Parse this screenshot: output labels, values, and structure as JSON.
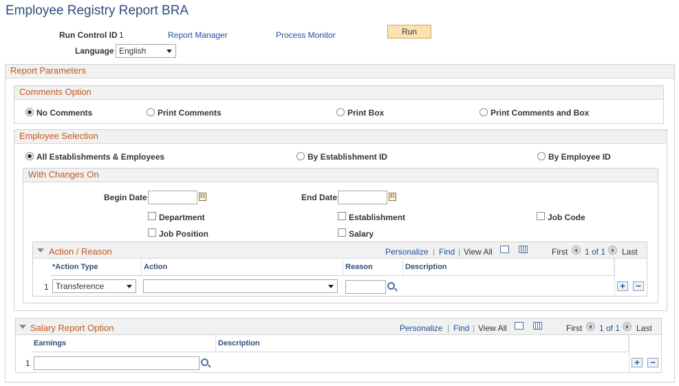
{
  "page": {
    "title": "Employee Registry Report BRA"
  },
  "header": {
    "run_control_label": "Run Control ID",
    "run_control_value": "1",
    "report_manager": "Report Manager",
    "process_monitor": "Process Monitor",
    "run_label": "Run",
    "language_label": "Language",
    "language_value": "English"
  },
  "report_parameters": {
    "title": "Report Parameters"
  },
  "comments_option": {
    "title": "Comments Option",
    "options": [
      "No Comments",
      "Print Comments",
      "Print Box",
      "Print Comments and Box"
    ],
    "selected": "No Comments"
  },
  "employee_selection": {
    "title": "Employee Selection",
    "options": [
      "All Establishments & Employees",
      "By Establishment ID",
      "By Employee ID"
    ],
    "selected": "All Establishments & Employees"
  },
  "with_changes_on": {
    "title": "With Changes On",
    "begin_date_label": "Begin Date",
    "begin_date_value": "",
    "end_date_label": "End Date",
    "end_date_value": "",
    "checkboxes": [
      "Department",
      "Establishment",
      "Job Code",
      "Job Position",
      "Salary"
    ]
  },
  "action_reason": {
    "title": "Action / Reason",
    "nav": {
      "personalize": "Personalize",
      "find": "Find",
      "view_all": "View All",
      "first": "First",
      "range": "1 of 1",
      "last": "Last",
      "sep": "|"
    },
    "columns": [
      "*Action Type",
      "Action",
      "Reason",
      "Description"
    ],
    "rows": [
      {
        "num": "1",
        "action_type": "Transference",
        "action": "",
        "reason": "",
        "description": ""
      }
    ]
  },
  "salary_report_option": {
    "title": "Salary Report Option",
    "nav": {
      "personalize": "Personalize",
      "find": "Find",
      "view_all": "View All",
      "first": "First",
      "range": "1 of 1",
      "last": "Last",
      "sep": "|"
    },
    "columns": [
      "Earnings",
      "Description"
    ],
    "rows": [
      {
        "num": "1",
        "earnings": "",
        "description": ""
      }
    ]
  },
  "icons": {
    "calendar": "calendar-icon",
    "lookup": "magnifier-icon",
    "add": "plus-icon",
    "remove": "minus-icon"
  },
  "colors": {
    "title": "#2a4f7a",
    "section_header": "#c1571e",
    "link": "#1c4f9c",
    "run_button": "#fde2b1"
  }
}
